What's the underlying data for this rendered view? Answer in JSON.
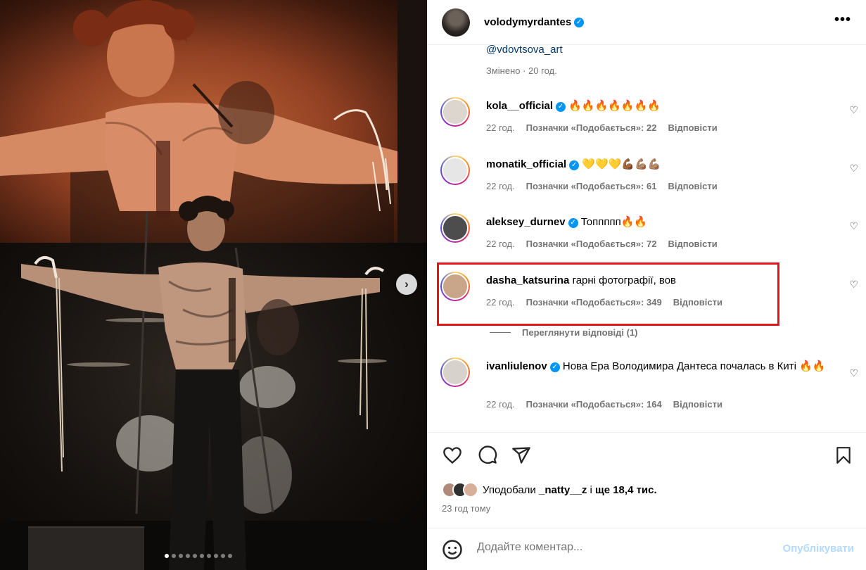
{
  "post": {
    "author": "volodymyrdantes",
    "more_label": "•••",
    "caption_tail_link": "@vdovtsova_art",
    "caption_meta": "Змінено · 20 год."
  },
  "media": {
    "next_label": "›",
    "dots_total": 10,
    "dots_active_index": 0
  },
  "labels": {
    "likes_prefix": "Позначки «Подобається»:",
    "reply": "Відповісти"
  },
  "comments": [
    {
      "user": "kola__official",
      "text": "🔥🔥🔥🔥🔥🔥🔥",
      "time": "22 год.",
      "likes": "22"
    },
    {
      "user": "monatik_official",
      "text": "💛💛💛💪🏾💪🏽💪🏽",
      "time": "22 год.",
      "likes": "61"
    },
    {
      "user": "aleksey_durnev",
      "text": "Топпппп🔥🔥",
      "time": "22 год.",
      "likes": "72"
    },
    {
      "user": "dasha_katsurina",
      "text": "гарні фотографії, вов",
      "time": "22 год.",
      "likes": "349"
    },
    {
      "user": "ivanliulenov",
      "text": "Нова Ера Володимира Дантеса почалась в Киті 🔥🔥",
      "time": "22 год.",
      "likes": "164"
    }
  ],
  "view_replies": "Переглянути відповіді (1)",
  "likes_summary": {
    "prefix": "Уподобали",
    "user": "_natty__z",
    "middle": "і",
    "count": "ще 18,4 тис."
  },
  "time_ago": "23 год тому",
  "composer": {
    "placeholder": "Додайте коментар...",
    "publish": "Опублікувати"
  },
  "colors": {
    "accent": "#0095f6",
    "highlight": "#e8141c",
    "publish_disabled": "#b3dbff"
  }
}
